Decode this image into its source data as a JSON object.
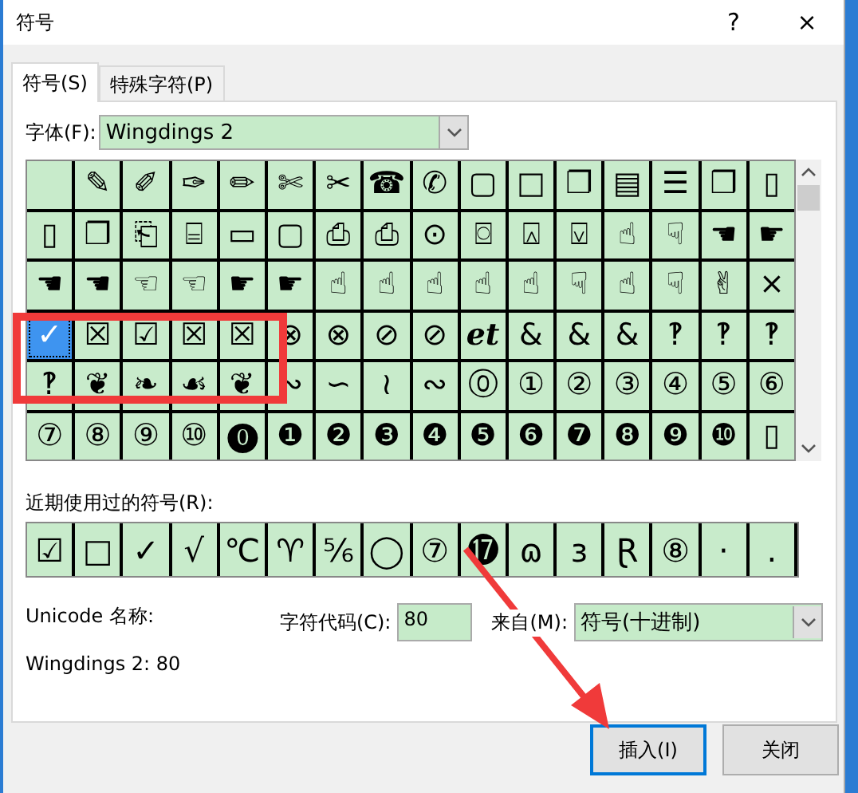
{
  "window": {
    "title": "符号",
    "help_button": "?",
    "close_button": "×"
  },
  "tabs": [
    {
      "label": "符号(S)",
      "selected": true
    },
    {
      "label": "特殊字符(P)",
      "selected": false
    }
  ],
  "font": {
    "label": "字体(F):",
    "value": "Wingdings 2"
  },
  "symbol_grid": {
    "rows": [
      [
        {
          "selected": false
        },
        {
          "glyph": "✎",
          "selected": false
        },
        {
          "glyph": "✐",
          "selected": false
        },
        {
          "glyph": "✑",
          "selected": false
        },
        {
          "glyph": "✏",
          "selected": false
        },
        {
          "glyph": "✄",
          "selected": false
        },
        {
          "glyph": "✂",
          "selected": false
        },
        {
          "glyph": "☎",
          "selected": false
        },
        {
          "glyph": "✆",
          "selected": false
        },
        {
          "glyph": "▢",
          "selected": false
        },
        {
          "glyph": "□",
          "selected": false
        },
        {
          "glyph": "❐",
          "selected": false
        },
        {
          "glyph": "▤",
          "selected": false
        },
        {
          "glyph": "☰",
          "selected": false
        },
        {
          "glyph": "❒",
          "selected": false
        },
        {
          "glyph": "▯",
          "selected": false
        }
      ],
      [
        {
          "glyph": "▯",
          "selected": false
        },
        {
          "glyph": "❐",
          "selected": false
        },
        {
          "glyph": "⎗",
          "selected": false
        },
        {
          "glyph": "⌸",
          "selected": false
        },
        {
          "glyph": "▭",
          "selected": false
        },
        {
          "glyph": "▢",
          "selected": false
        },
        {
          "glyph": "⎙",
          "selected": false
        },
        {
          "glyph": "⎙",
          "selected": false
        },
        {
          "glyph": "⊙",
          "selected": false
        },
        {
          "glyph": "⌼",
          "selected": false
        },
        {
          "glyph": "⍓",
          "selected": false
        },
        {
          "glyph": "⍌",
          "selected": false
        },
        {
          "glyph": "☝",
          "selected": false
        },
        {
          "glyph": "☟",
          "selected": false
        },
        {
          "glyph": "☚",
          "selected": false
        },
        {
          "glyph": "☛",
          "selected": false
        }
      ],
      [
        {
          "glyph": "☚",
          "selected": false
        },
        {
          "glyph": "☚",
          "selected": false
        },
        {
          "glyph": "☜",
          "selected": false
        },
        {
          "glyph": "☜",
          "selected": false
        },
        {
          "glyph": "☛",
          "selected": false
        },
        {
          "glyph": "☛",
          "selected": false
        },
        {
          "glyph": "☝",
          "selected": false
        },
        {
          "glyph": "☝",
          "selected": false
        },
        {
          "glyph": "☝",
          "selected": false
        },
        {
          "glyph": "☝",
          "selected": false
        },
        {
          "glyph": "☝",
          "selected": false
        },
        {
          "glyph": "☟",
          "selected": false
        },
        {
          "glyph": "☝",
          "selected": false
        },
        {
          "glyph": "☟",
          "selected": false
        },
        {
          "glyph": "✌",
          "selected": false
        },
        {
          "glyph": "×",
          "selected": false
        }
      ],
      [
        {
          "glyph": "✓",
          "selected": true
        },
        {
          "glyph": "☒",
          "selected": false
        },
        {
          "glyph": "☑",
          "selected": false
        },
        {
          "glyph": "☒",
          "selected": false
        },
        {
          "glyph": "☒",
          "selected": false
        },
        {
          "glyph": "⊗",
          "selected": false
        },
        {
          "glyph": "⊗",
          "selected": false
        },
        {
          "glyph": "⊘",
          "selected": false
        },
        {
          "glyph": "⊘",
          "selected": false
        },
        {
          "glyph": "et",
          "selected": false
        },
        {
          "glyph": "&",
          "selected": false
        },
        {
          "glyph": "&",
          "selected": false
        },
        {
          "glyph": "&",
          "selected": false
        },
        {
          "glyph": "‽",
          "selected": false
        },
        {
          "glyph": "‽",
          "selected": false
        },
        {
          "glyph": "‽",
          "selected": false
        }
      ],
      [
        {
          "glyph": "‽",
          "selected": false
        },
        {
          "glyph": "❦",
          "selected": false
        },
        {
          "glyph": "❧",
          "selected": false
        },
        {
          "glyph": "☙",
          "selected": false
        },
        {
          "glyph": "❦",
          "selected": false
        },
        {
          "glyph": "∾",
          "selected": false
        },
        {
          "glyph": "∽",
          "selected": false
        },
        {
          "glyph": "≀",
          "selected": false
        },
        {
          "glyph": "∾",
          "selected": false
        },
        {
          "glyph": "⓪",
          "selected": false
        },
        {
          "glyph": "①",
          "selected": false
        },
        {
          "glyph": "②",
          "selected": false
        },
        {
          "glyph": "③",
          "selected": false
        },
        {
          "glyph": "④",
          "selected": false
        },
        {
          "glyph": "⑤",
          "selected": false
        },
        {
          "glyph": "⑥",
          "selected": false
        }
      ],
      [
        {
          "glyph": "⑦",
          "selected": false
        },
        {
          "glyph": "⑧",
          "selected": false
        },
        {
          "glyph": "⑨",
          "selected": false
        },
        {
          "glyph": "⑩",
          "selected": false
        },
        {
          "glyph": "⓿",
          "selected": false
        },
        {
          "glyph": "❶",
          "selected": false
        },
        {
          "glyph": "❷",
          "selected": false
        },
        {
          "glyph": "❸",
          "selected": false
        },
        {
          "glyph": "❹",
          "selected": false
        },
        {
          "glyph": "❺",
          "selected": false
        },
        {
          "glyph": "❻",
          "selected": false
        },
        {
          "glyph": "❼",
          "selected": false
        },
        {
          "glyph": "❽",
          "selected": false
        },
        {
          "glyph": "❾",
          "selected": false
        },
        {
          "glyph": "❿",
          "selected": false
        },
        {
          "glyph": "▯",
          "selected": false
        }
      ]
    ]
  },
  "recent": {
    "label": "近期使用过的符号(R):",
    "symbols": [
      "☑",
      "□",
      "✓",
      "√",
      "℃",
      "♈",
      "⅚",
      "◯",
      "⑦",
      "⓱",
      "ɷ",
      "ɜ",
      "Ɽ",
      "⑧",
      "·",
      "."
    ]
  },
  "unicode_name": {
    "label": "Unicode 名称:",
    "value": "Wingdings 2: 80"
  },
  "char_code": {
    "label": "字符代码(C):",
    "value": "80"
  },
  "from": {
    "label": "来自(M):",
    "value": "符号(十进制)"
  },
  "buttons": [
    {
      "label": "插入(I)",
      "kind": "default"
    },
    {
      "label": "关闭",
      "kind": "normal"
    }
  ]
}
